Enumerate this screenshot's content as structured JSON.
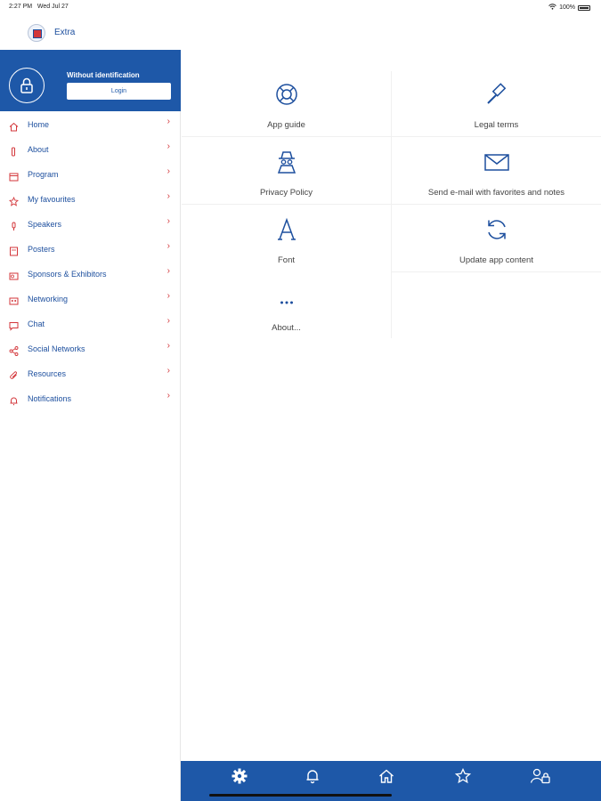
{
  "status": {
    "time": "2:27 PM",
    "date": "Wed Jul 27",
    "battery": "100%"
  },
  "header": {
    "title": "Extra"
  },
  "identity": {
    "label": "Without identification",
    "login_label": "Login"
  },
  "menu": [
    {
      "label": "Home",
      "icon": "home-icon"
    },
    {
      "label": "About",
      "icon": "info-icon"
    },
    {
      "label": "Program",
      "icon": "calendar-icon"
    },
    {
      "label": "My favourites",
      "icon": "star-icon"
    },
    {
      "label": "Speakers",
      "icon": "microphone-icon"
    },
    {
      "label": "Posters",
      "icon": "poster-icon"
    },
    {
      "label": "Sponsors & Exhibitors",
      "icon": "sponsors-icon"
    },
    {
      "label": "Networking",
      "icon": "networking-icon"
    },
    {
      "label": "Chat",
      "icon": "chat-icon"
    },
    {
      "label": "Social Networks",
      "icon": "share-icon"
    },
    {
      "label": "Resources",
      "icon": "paperclip-icon"
    },
    {
      "label": "Notifications",
      "icon": "bell-icon"
    }
  ],
  "tiles": [
    {
      "label": "App guide",
      "icon": "lifebuoy-icon"
    },
    {
      "label": "Legal terms",
      "icon": "gavel-icon"
    },
    {
      "label": "Privacy Policy",
      "icon": "spy-icon"
    },
    {
      "label": "Send e-mail with favorites and notes",
      "icon": "envelope-icon"
    },
    {
      "label": "Font",
      "icon": "font-icon"
    },
    {
      "label": "Update app content",
      "icon": "refresh-icon"
    },
    {
      "label": "About...",
      "icon": "ellipsis-icon"
    }
  ],
  "tabbar": [
    "gear-icon",
    "bell-icon",
    "home-icon",
    "star-icon",
    "user-lock-icon"
  ],
  "colors": {
    "primary": "#1e58a8",
    "accent": "#d3363a"
  }
}
